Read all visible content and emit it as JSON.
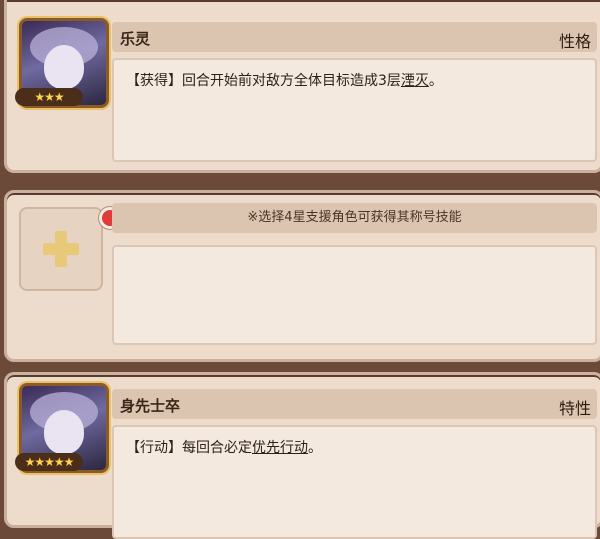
{
  "cards": [
    {
      "name": "乐灵",
      "tag": "性格",
      "stars": "★★★",
      "description_prefix": "【获得】回合开始前对敌方全体目标造成3层",
      "description_keyword": "湮灭",
      "description_suffix": "。"
    },
    {
      "hint": "※选择4星支援角色可获得其称号技能",
      "plus_icon": "plus-icon",
      "notification": "red-dot"
    },
    {
      "name": "身先士卒",
      "tag": "特性",
      "stars": "★★★★★",
      "description_prefix": "【行动】每回合必定",
      "description_keyword": "优先行动",
      "description_suffix": "。"
    }
  ],
  "colors": {
    "background": "#6b4a3a",
    "card": "#eddccc",
    "title_bar": "#dcc5b0",
    "star": "#ffd34d",
    "red_dot": "#e03a3a",
    "plus": "#e8c97a"
  }
}
